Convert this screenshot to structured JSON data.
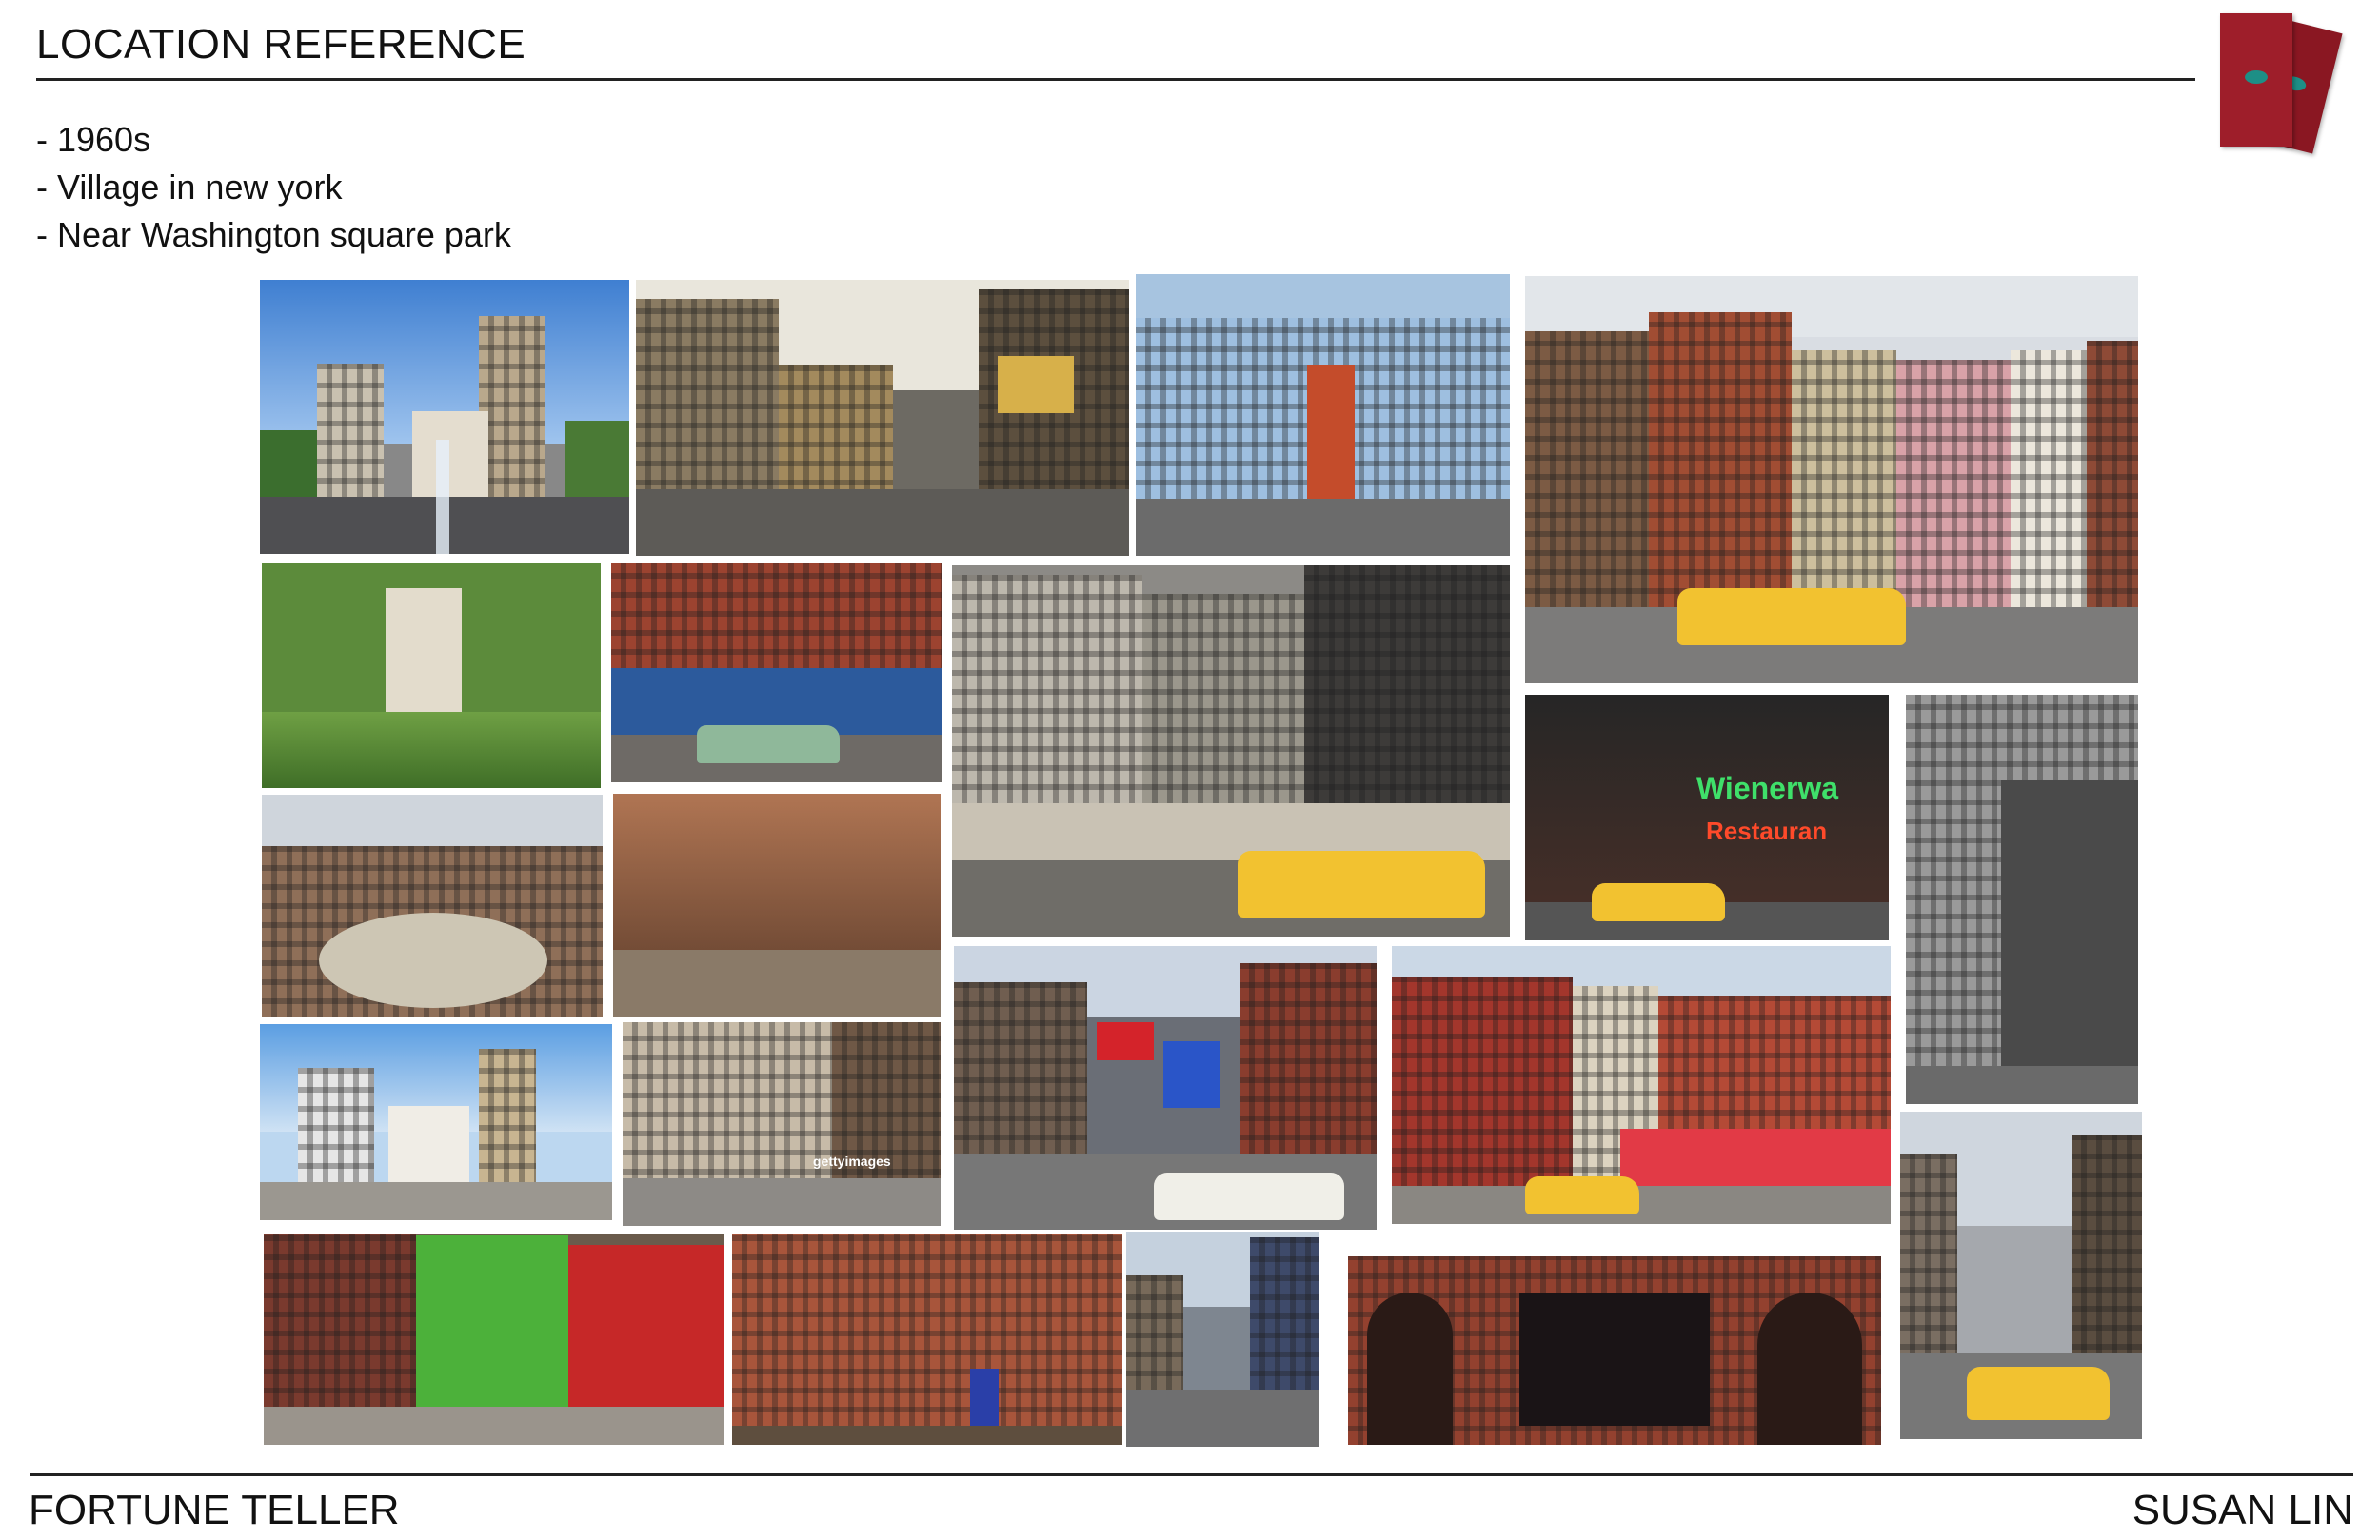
{
  "header": {
    "title": "LOCATION REFERENCE"
  },
  "notes": [
    "- 1960s",
    "- Village in new york",
    "- Near Washington square park"
  ],
  "footer": {
    "left": "FORTUNE TELLER",
    "right": "SUSAN LIN"
  },
  "logo": {
    "icon": "tarot-cards-eye-icon",
    "colors": {
      "card": "#9e1e2a",
      "eye": "#1d8f86"
    }
  },
  "photos": [
    {
      "name": "washington-square-arch-fountain-photo"
    },
    {
      "name": "times-square-vintage-street-photo"
    },
    {
      "name": "blue-building-fire-escapes-photo"
    },
    {
      "name": "village-street-yellow-cab-photo"
    },
    {
      "name": "washington-square-park-crowd-photo"
    },
    {
      "name": "brick-storefront-green-car-photo"
    },
    {
      "name": "midtown-storefronts-taxi-photo"
    },
    {
      "name": "washington-square-aerial-photo"
    },
    {
      "name": "tree-lined-village-street-photo"
    },
    {
      "name": "wienerwald-restaurant-street-photo"
    },
    {
      "name": "black-white-storefront-photo"
    },
    {
      "name": "washington-square-arch-day-photo"
    },
    {
      "name": "brownstone-row-houses-photo"
    },
    {
      "name": "times-square-coca-cola-traffic-photo"
    },
    {
      "name": "red-brick-corner-cafe-taxi-photo"
    },
    {
      "name": "manhattan-avenue-yellow-cab-photo"
    },
    {
      "name": "colorful-shops-sidewalk-photo"
    },
    {
      "name": "red-brick-townhouses-photo"
    },
    {
      "name": "admiral-sign-street-photo"
    },
    {
      "name": "stonewall-inn-facade-photo"
    }
  ]
}
